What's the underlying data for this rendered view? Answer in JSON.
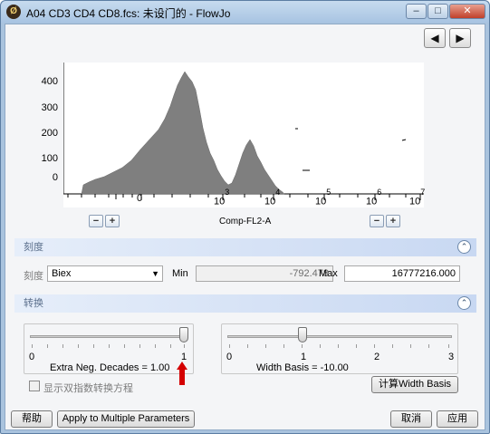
{
  "window": {
    "title": "A04 CD3 CD4 CD8.fcs: 未设门的 - FlowJo",
    "app_icon": "Ø",
    "controls": {
      "minimize": "–",
      "maximize": "□",
      "close": "✕"
    }
  },
  "nav": {
    "prev": "◀",
    "next": "▶"
  },
  "histogram": {
    "y_ticks": [
      "400",
      "300",
      "200",
      "100",
      "0"
    ],
    "x_labels": [
      {
        "base": "0",
        "exp": ""
      },
      {
        "base": "10",
        "exp": "3"
      },
      {
        "base": "10",
        "exp": "4"
      },
      {
        "base": "10",
        "exp": "5"
      },
      {
        "base": "10",
        "exp": "6"
      },
      {
        "base": "10",
        "exp": "7"
      }
    ],
    "axis_name": "Comp-FL2-A",
    "fill_color": "#7f7f7f",
    "zoom_minus": "−",
    "zoom_plus": "+"
  },
  "scale_section": {
    "header": "刻度",
    "collapse_icon": "⌃",
    "scale_label": "刻度",
    "scale_value": "Biex",
    "min_label": "Min",
    "min_value": "-792.478",
    "max_label": "Max",
    "max_value": "16777216.000"
  },
  "transform_section": {
    "header": "转换",
    "collapse_icon": "⌃",
    "neg_decades": {
      "ticks": [
        "0",
        "1"
      ],
      "caption": "Extra Neg. Decades = 1.00",
      "value": 1.0
    },
    "width_basis": {
      "ticks": [
        "0",
        "1",
        "2",
        "3"
      ],
      "caption": "Width Basis = -10.00",
      "value": 1.0
    },
    "show_formula_label": "显示双指数转换方程",
    "compute_button": "计算Width Basis"
  },
  "footer": {
    "help": "帮助",
    "apply_multi": "Apply to Multiple Parameters",
    "cancel": "取消",
    "apply": "应用"
  },
  "accent_colors": {
    "section_header": "#c8d8f2",
    "indicator_arrow": "#d40000"
  }
}
